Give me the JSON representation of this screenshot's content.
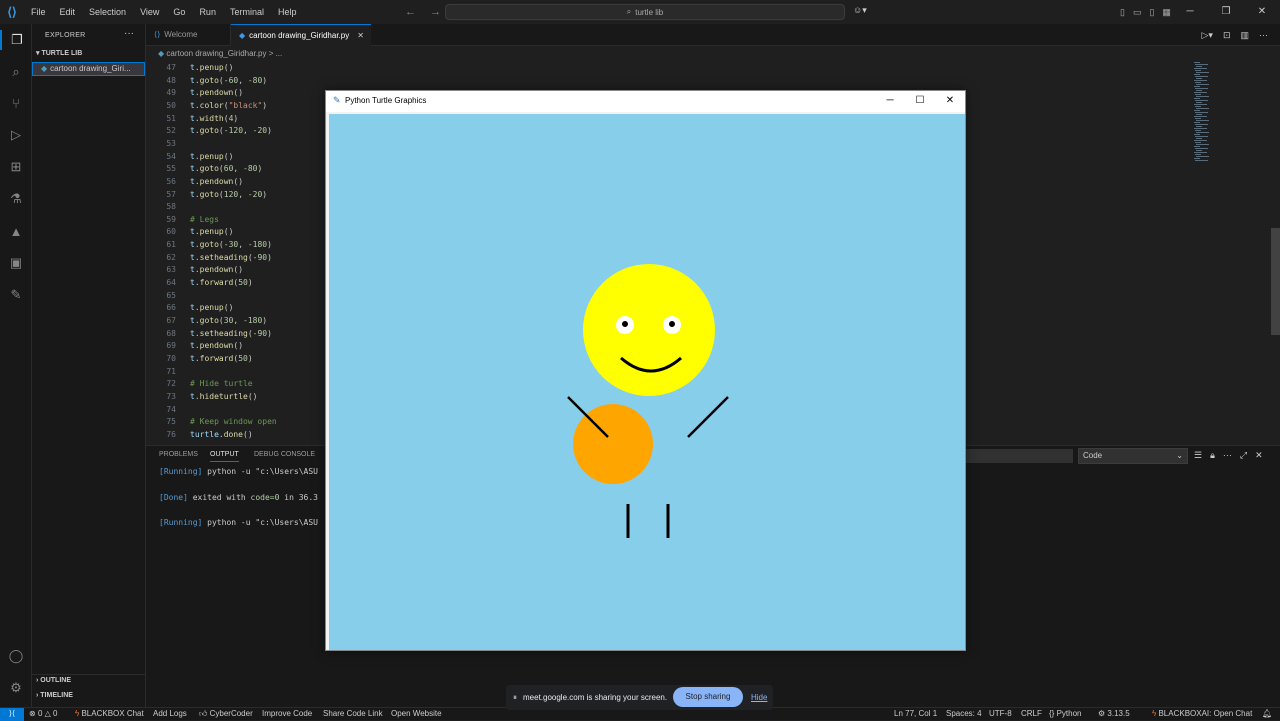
{
  "menu": [
    "File",
    "Edit",
    "Selection",
    "View",
    "Go",
    "Run",
    "Terminal",
    "Help"
  ],
  "search": {
    "text": "turtle lib"
  },
  "explorer": {
    "title": "EXPLORER",
    "folder": "TURTLE LIB",
    "file": "cartoon drawing_Giri...",
    "outline": "OUTLINE",
    "timeline": "TIMELINE"
  },
  "tabs": {
    "welcome": "Welcome",
    "file": "cartoon drawing_Giridhar.py"
  },
  "breadcrumb": {
    "file": "cartoon drawing_Giridhar.py",
    "rest": "> ..."
  },
  "code": [
    {
      "n": "47",
      "t": [
        [
          "obj",
          "t"
        ],
        [
          "pun",
          "."
        ],
        [
          "fn",
          "penup"
        ],
        [
          "pun",
          "()"
        ]
      ]
    },
    {
      "n": "48",
      "t": [
        [
          "obj",
          "t"
        ],
        [
          "pun",
          "."
        ],
        [
          "fn",
          "goto"
        ],
        [
          "pun",
          "("
        ],
        [
          "num",
          "-60"
        ],
        [
          "pun",
          ", "
        ],
        [
          "num",
          "-80"
        ],
        [
          "pun",
          ")"
        ]
      ]
    },
    {
      "n": "49",
      "t": [
        [
          "obj",
          "t"
        ],
        [
          "pun",
          "."
        ],
        [
          "fn",
          "pendown"
        ],
        [
          "pun",
          "()"
        ]
      ]
    },
    {
      "n": "50",
      "t": [
        [
          "obj",
          "t"
        ],
        [
          "pun",
          "."
        ],
        [
          "fn",
          "color"
        ],
        [
          "pun",
          "("
        ],
        [
          "str",
          "\"black\""
        ],
        [
          "pun",
          ")"
        ]
      ]
    },
    {
      "n": "51",
      "t": [
        [
          "obj",
          "t"
        ],
        [
          "pun",
          "."
        ],
        [
          "fn",
          "width"
        ],
        [
          "pun",
          "("
        ],
        [
          "num",
          "4"
        ],
        [
          "pun",
          ")"
        ]
      ]
    },
    {
      "n": "52",
      "t": [
        [
          "obj",
          "t"
        ],
        [
          "pun",
          "."
        ],
        [
          "fn",
          "goto"
        ],
        [
          "pun",
          "("
        ],
        [
          "num",
          "-120"
        ],
        [
          "pun",
          ", "
        ],
        [
          "num",
          "-20"
        ],
        [
          "pun",
          ")"
        ]
      ]
    },
    {
      "n": "53",
      "t": []
    },
    {
      "n": "54",
      "t": [
        [
          "obj",
          "t"
        ],
        [
          "pun",
          "."
        ],
        [
          "fn",
          "penup"
        ],
        [
          "pun",
          "()"
        ]
      ]
    },
    {
      "n": "55",
      "t": [
        [
          "obj",
          "t"
        ],
        [
          "pun",
          "."
        ],
        [
          "fn",
          "goto"
        ],
        [
          "pun",
          "("
        ],
        [
          "num",
          "60"
        ],
        [
          "pun",
          ", "
        ],
        [
          "num",
          "-80"
        ],
        [
          "pun",
          ")"
        ]
      ]
    },
    {
      "n": "56",
      "t": [
        [
          "obj",
          "t"
        ],
        [
          "pun",
          "."
        ],
        [
          "fn",
          "pendown"
        ],
        [
          "pun",
          "()"
        ]
      ]
    },
    {
      "n": "57",
      "t": [
        [
          "obj",
          "t"
        ],
        [
          "pun",
          "."
        ],
        [
          "fn",
          "goto"
        ],
        [
          "pun",
          "("
        ],
        [
          "num",
          "120"
        ],
        [
          "pun",
          ", "
        ],
        [
          "num",
          "-20"
        ],
        [
          "pun",
          ")"
        ]
      ]
    },
    {
      "n": "58",
      "t": []
    },
    {
      "n": "59",
      "t": [
        [
          "com",
          "# Legs"
        ]
      ]
    },
    {
      "n": "60",
      "t": [
        [
          "obj",
          "t"
        ],
        [
          "pun",
          "."
        ],
        [
          "fn",
          "penup"
        ],
        [
          "pun",
          "()"
        ]
      ]
    },
    {
      "n": "61",
      "t": [
        [
          "obj",
          "t"
        ],
        [
          "pun",
          "."
        ],
        [
          "fn",
          "goto"
        ],
        [
          "pun",
          "("
        ],
        [
          "num",
          "-30"
        ],
        [
          "pun",
          ", "
        ],
        [
          "num",
          "-180"
        ],
        [
          "pun",
          ")"
        ]
      ]
    },
    {
      "n": "62",
      "t": [
        [
          "obj",
          "t"
        ],
        [
          "pun",
          "."
        ],
        [
          "fn",
          "setheading"
        ],
        [
          "pun",
          "("
        ],
        [
          "num",
          "-90"
        ],
        [
          "pun",
          ")"
        ]
      ]
    },
    {
      "n": "63",
      "t": [
        [
          "obj",
          "t"
        ],
        [
          "pun",
          "."
        ],
        [
          "fn",
          "pendown"
        ],
        [
          "pun",
          "()"
        ]
      ]
    },
    {
      "n": "64",
      "t": [
        [
          "obj",
          "t"
        ],
        [
          "pun",
          "."
        ],
        [
          "fn",
          "forward"
        ],
        [
          "pun",
          "("
        ],
        [
          "num",
          "50"
        ],
        [
          "pun",
          ")"
        ]
      ]
    },
    {
      "n": "65",
      "t": []
    },
    {
      "n": "66",
      "t": [
        [
          "obj",
          "t"
        ],
        [
          "pun",
          "."
        ],
        [
          "fn",
          "penup"
        ],
        [
          "pun",
          "()"
        ]
      ]
    },
    {
      "n": "67",
      "t": [
        [
          "obj",
          "t"
        ],
        [
          "pun",
          "."
        ],
        [
          "fn",
          "goto"
        ],
        [
          "pun",
          "("
        ],
        [
          "num",
          "30"
        ],
        [
          "pun",
          ", "
        ],
        [
          "num",
          "-180"
        ],
        [
          "pun",
          ")"
        ]
      ]
    },
    {
      "n": "68",
      "t": [
        [
          "obj",
          "t"
        ],
        [
          "pun",
          "."
        ],
        [
          "fn",
          "setheading"
        ],
        [
          "pun",
          "("
        ],
        [
          "num",
          "-90"
        ],
        [
          "pun",
          ")"
        ]
      ]
    },
    {
      "n": "69",
      "t": [
        [
          "obj",
          "t"
        ],
        [
          "pun",
          "."
        ],
        [
          "fn",
          "pendown"
        ],
        [
          "pun",
          "()"
        ]
      ]
    },
    {
      "n": "70",
      "t": [
        [
          "obj",
          "t"
        ],
        [
          "pun",
          "."
        ],
        [
          "fn",
          "forward"
        ],
        [
          "pun",
          "("
        ],
        [
          "num",
          "50"
        ],
        [
          "pun",
          ")"
        ]
      ]
    },
    {
      "n": "71",
      "t": []
    },
    {
      "n": "72",
      "t": [
        [
          "com",
          "# Hide turtle"
        ]
      ]
    },
    {
      "n": "73",
      "t": [
        [
          "obj",
          "t"
        ],
        [
          "pun",
          "."
        ],
        [
          "fn",
          "hideturtle"
        ],
        [
          "pun",
          "()"
        ]
      ]
    },
    {
      "n": "74",
      "t": []
    },
    {
      "n": "75",
      "t": [
        [
          "com",
          "# Keep window open"
        ]
      ]
    },
    {
      "n": "76",
      "t": [
        [
          "obj",
          "turtle"
        ],
        [
          "pun",
          "."
        ],
        [
          "fn",
          "done"
        ],
        [
          "pun",
          "()"
        ]
      ]
    }
  ],
  "panel": {
    "tabs": [
      "PROBLEMS",
      "OUTPUT",
      "DEBUG CONSOLE"
    ],
    "active_tab": "OUTPUT",
    "channel": "Code",
    "lines": [
      {
        "kind": "run",
        "prefix": "[Running]",
        "text": " python -u \"c:\\Users\\ASU"
      },
      {
        "kind": "done",
        "prefix": "[Done]",
        "text": " exited with ",
        "code": "code=0",
        "tail": " in 36.3"
      },
      {
        "kind": "run",
        "prefix": "[Running]",
        "text": " python -u \"c:\\Users\\ASU"
      }
    ]
  },
  "turtle_window": {
    "title": "Python Turtle Graphics",
    "background": "#87ceeb",
    "head_color": "#ffff00",
    "body_color": "#ffa500",
    "line_color": "#000000"
  },
  "status": {
    "errors": "0",
    "warnings": "0",
    "blackbox_chat": "BLACKBOX Chat",
    "add_logs": "Add Logs",
    "cybercoder": "CyberCoder",
    "improve_code": "Improve Code",
    "share_code_link": "Share Code Link",
    "open_website": "Open Website",
    "position": "Ln 77, Col 1",
    "spaces": "Spaces: 4",
    "encoding": "UTF-8",
    "eol": "CRLF",
    "language": "Python",
    "py_version": "3.13.5",
    "blackbox_open_chat": "BLACKBOXAI: Open Chat"
  },
  "share": {
    "message": "meet.google.com is sharing your screen.",
    "stop_label": "Stop sharing",
    "hide_label": "Hide"
  }
}
